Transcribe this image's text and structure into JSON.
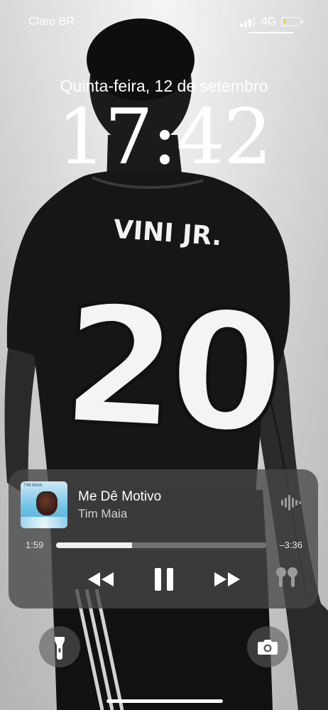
{
  "status_bar": {
    "carrier": "Claro BR",
    "network": "4G",
    "battery_level": 0.18,
    "battery_color": "#f0d34a",
    "signal_bars_active": 3
  },
  "lock_screen": {
    "date": "Quinta-feira, 12 de setembro",
    "time": "17:42"
  },
  "wallpaper": {
    "jersey_name": "VINI JR.",
    "jersey_number": "20"
  },
  "now_playing": {
    "artwork_text": "TIM MAIA",
    "title": "Me Dê Motivo",
    "artist": "Tim Maia",
    "elapsed": "1:59",
    "remaining": "–3:36",
    "progress": 0.36,
    "icons": {
      "waveform": "waveform-icon",
      "rewind": "rewind-icon",
      "pause": "pause-icon",
      "forward": "fast-forward-icon",
      "output": "airpods-icon"
    }
  },
  "quick_actions": {
    "left": "flashlight-icon",
    "right": "camera-icon"
  }
}
